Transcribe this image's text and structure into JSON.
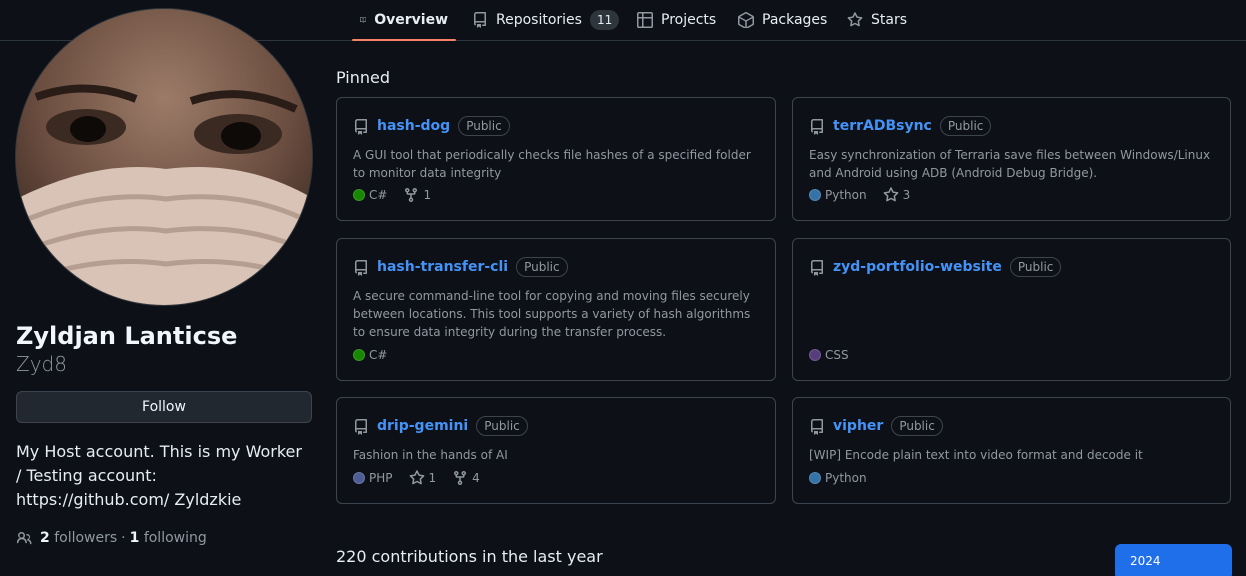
{
  "tabs": [
    {
      "label": "Overview",
      "icon": "book-icon",
      "active": true
    },
    {
      "label": "Repositories",
      "icon": "repo-icon",
      "count": "11"
    },
    {
      "label": "Projects",
      "icon": "table-icon"
    },
    {
      "label": "Packages",
      "icon": "package-icon"
    },
    {
      "label": "Stars",
      "icon": "star-icon"
    }
  ],
  "profile": {
    "name": "Zyldjan Lanticse",
    "login": "Zyd8",
    "follow_label": "Follow",
    "bio": "My Host account. This is my Worker / Testing account: https://github.com/ Zyldzkie",
    "followers_count": "2",
    "followers_label": "followers",
    "separator": "·",
    "following_count": "1",
    "following_label": "following"
  },
  "pinned": {
    "title": "Pinned",
    "repos": [
      {
        "name": "hash-dog",
        "visibility": "Public",
        "description": "A GUI tool that periodically checks file hashes of a specified folder to monitor data integrity",
        "language": "C#",
        "lang_color": "#178600",
        "forks": "1"
      },
      {
        "name": "terrADBsync",
        "visibility": "Public",
        "description": "Easy synchronization of Terraria save files between Windows/Linux and Android using ADB (Android Debug Bridge).",
        "language": "Python",
        "lang_color": "#3572A5",
        "stars": "3"
      },
      {
        "name": "hash-transfer-cli",
        "visibility": "Public",
        "description": "A secure command-line tool for copying and moving files securely between locations. This tool supports a variety of hash algorithms to ensure data integrity during the transfer process.",
        "language": "C#",
        "lang_color": "#178600"
      },
      {
        "name": "zyd-portfolio-website",
        "visibility": "Public",
        "description": "",
        "language": "CSS",
        "lang_color": "#563d7c"
      },
      {
        "name": "drip-gemini",
        "visibility": "Public",
        "description": "Fashion in the hands of AI",
        "language": "PHP",
        "lang_color": "#4F5D95",
        "stars": "1",
        "forks": "4"
      },
      {
        "name": "vipher",
        "visibility": "Public",
        "description": "[WIP] Encode plain text into video format and decode it",
        "language": "Python",
        "lang_color": "#3572A5"
      }
    ]
  },
  "contributions": {
    "summary": "220 contributions in the last year",
    "year": "2024"
  }
}
